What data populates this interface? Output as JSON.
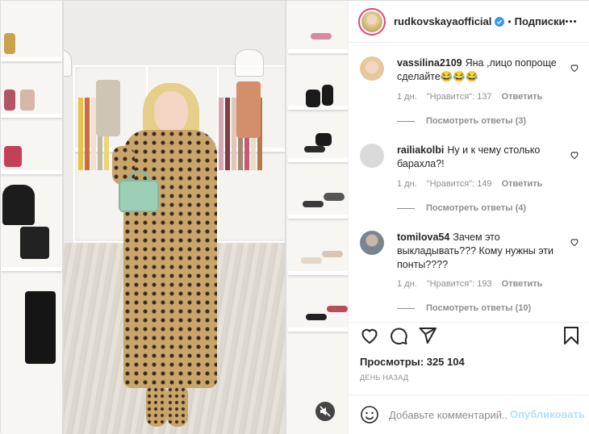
{
  "post": {
    "username": "rudkovskayaofficial",
    "separator": "•",
    "follow_label": "Подписки"
  },
  "comments": [
    {
      "username": "vassilina2109",
      "text": "Яна ,лицо попроще сделайте😂😂😂",
      "time": "1 дн.",
      "likes": "\"Нравится\": 137",
      "reply_label": "Ответить",
      "view_replies": "Посмотреть ответы (3)",
      "avatar_color": "#e7c89a"
    },
    {
      "username": "railiakolbi",
      "text": "Ну и к чему столько барахла?!",
      "time": "1 дн.",
      "likes": "\"Нравится\": 149",
      "reply_label": "Ответить",
      "view_replies": "Посмотреть ответы (4)",
      "avatar_color": "#dadada"
    },
    {
      "username": "tomilova54",
      "text": "Зачем это выкладывать??? Кому нужны эти понты????",
      "time": "1 дн.",
      "likes": "\"Нравится\": 193",
      "reply_label": "Ответить",
      "view_replies": "Посмотреть ответы (10)",
      "avatar_color": "#7b8590"
    }
  ],
  "stats": {
    "views_label": "Просмотры:",
    "views_count": "325 104",
    "date": "ДЕНЬ НАЗАД"
  },
  "add_comment": {
    "placeholder": "Добавьте комментарий...",
    "publish_label": "Опубликовать"
  },
  "icons": {
    "verified": "verified-badge-icon",
    "like": "heart-icon",
    "comment": "comment-icon",
    "share": "paper-plane-icon",
    "save": "bookmark-icon",
    "emoji": "smiley-icon",
    "mute": "speaker-muted-icon"
  },
  "colors": {
    "verified": "#3897f0",
    "publish_disabled": "#b2dffc",
    "story_ring": "#e0457b"
  }
}
